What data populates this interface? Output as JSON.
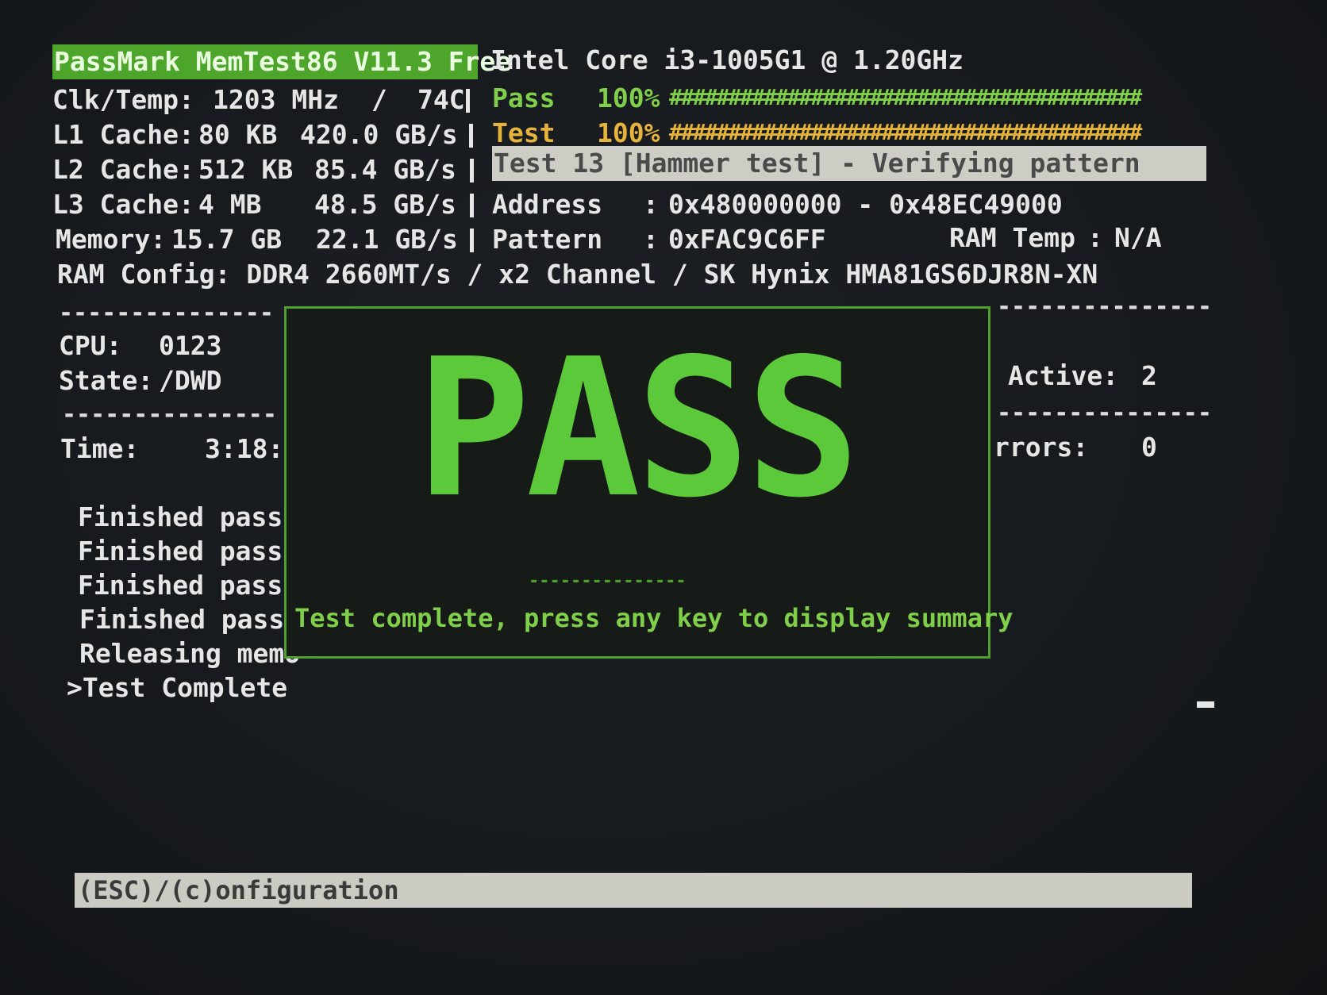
{
  "header": {
    "app_title": "PassMark MemTest86 V11.3 Free",
    "cpu_name": "Intel Core i3-1005G1 @ 1.20GHz"
  },
  "left_info": {
    "clk_label": "Clk/Temp:",
    "clk_value": "1203 MHz",
    "clk_slash": "/",
    "temp_value": "74C",
    "l1_label": "L1 Cache:",
    "l1_size": "80 KB",
    "l1_speed": "420.0 GB/s",
    "l2_label": "L2 Cache:",
    "l2_size": "512 KB",
    "l2_speed": "85.4 GB/s",
    "l3_label": "L3 Cache:",
    "l3_size": "4 MB",
    "l3_speed": "48.5 GB/s",
    "mem_label": "Memory:",
    "mem_size": "15.7 GB",
    "mem_speed": "22.1 GB/s",
    "ram_config": "RAM Config: DDR4 2660MT/s / x2 Channel / SK Hynix HMA81GS6DJR8N-XN"
  },
  "progress": {
    "pass_label": "Pass",
    "pass_percent": "100%",
    "pass_fraction": 1.0,
    "test_label": "Test",
    "test_percent": "100%",
    "test_fraction": 1.0,
    "hash_fill": "########################################"
  },
  "status_line": "Test 13 [Hammer test] - Verifying pattern",
  "address": {
    "label": "Address",
    "colon": ":",
    "value": "0x480000000 - 0x48EC49000"
  },
  "pattern": {
    "label": "Pattern",
    "colon": ":",
    "value": "0xFAC9C6FF"
  },
  "ram_temp": {
    "label": "RAM Temp",
    "colon": ":",
    "value": "N/A"
  },
  "cpu_state": {
    "cpu_label": "CPU:",
    "cpu_value": "0123",
    "state_label": "State:",
    "state_value": "/DWD"
  },
  "time": {
    "label": "Time:",
    "value": "3:18:"
  },
  "right_panel": {
    "active_label": "Active:",
    "active_value": "2",
    "errors_label": "rrors:",
    "errors_value": "0"
  },
  "log": [
    "Finished pass",
    "Finished pass",
    "Finished pass",
    "Finished pass",
    "Releasing memo",
    ">Test Complete"
  ],
  "result": {
    "big_text": "PASS",
    "message": "Test complete, press any key to display summary"
  },
  "footer": {
    "hint": "(ESC)/(c)onfiguration"
  },
  "separators": {
    "left": "---------------",
    "right": "---------------",
    "under_pass": "---------------"
  },
  "colors": {
    "accent_green": "#4ea52c",
    "pass_text_green": "#5cc93a",
    "test_yellow": "#e6b43a",
    "status_bar_grey": "#cdcdc6",
    "background": "#16191d"
  }
}
